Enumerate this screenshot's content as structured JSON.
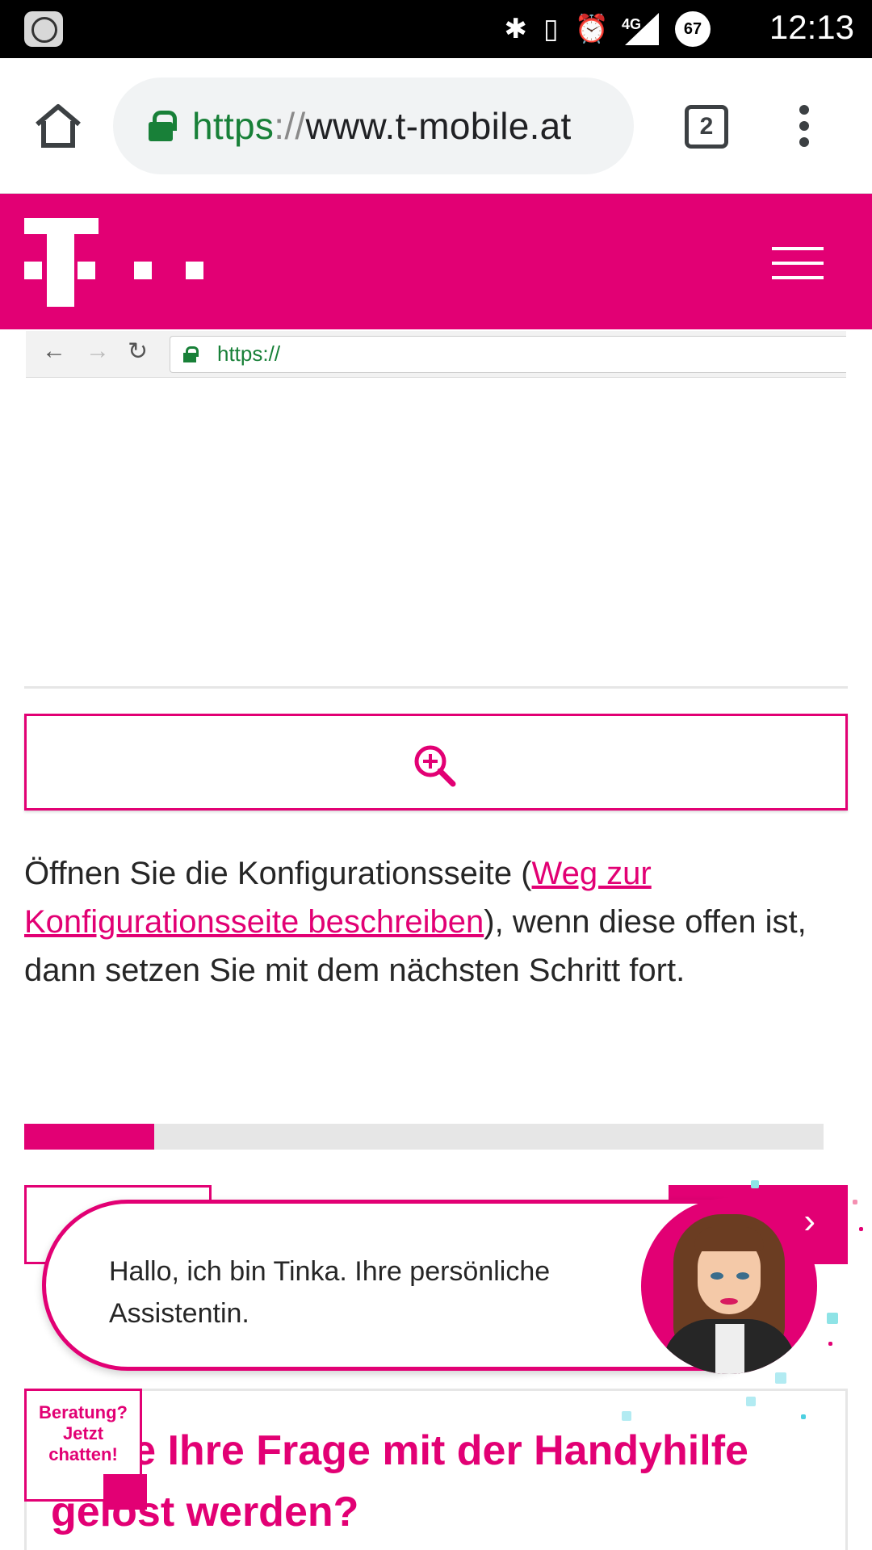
{
  "status_bar": {
    "time": "12:13",
    "network": "4G",
    "battery": "67"
  },
  "browser": {
    "url_scheme": "https",
    "url_separator": "://",
    "url_host": "www.t-mobile.at",
    "tab_count": "2"
  },
  "mock_browser": {
    "url": "https://"
  },
  "instructions": {
    "before_link": "Öffnen Sie die Konfigurationsseite (",
    "link_text": "Weg zur Konfigurationsseite beschreiben",
    "after_link": "), wenn diese offen ist, dann setzen Sie mit dem nächsten Schritt fort."
  },
  "progress": {
    "fraction": 0.163
  },
  "chat": {
    "greeting": "Hallo, ich bin Tinka. Ihre persönliche Assistentin.",
    "tab_line1": "Beratung?",
    "tab_line2": "Jetzt",
    "tab_line3": "chatten!"
  },
  "faq": {
    "title": "…nte Ihre Frage mit der Handyhilfe gelöst werden?"
  },
  "colors": {
    "brand": "#e20074",
    "secure_green": "#188038"
  },
  "icons": [
    "home-icon",
    "lock-icon",
    "tabs-icon",
    "overflow-menu-icon",
    "telekom-logo",
    "hamburger-menu-icon",
    "zoom-in-icon",
    "chevron-right-icon"
  ]
}
